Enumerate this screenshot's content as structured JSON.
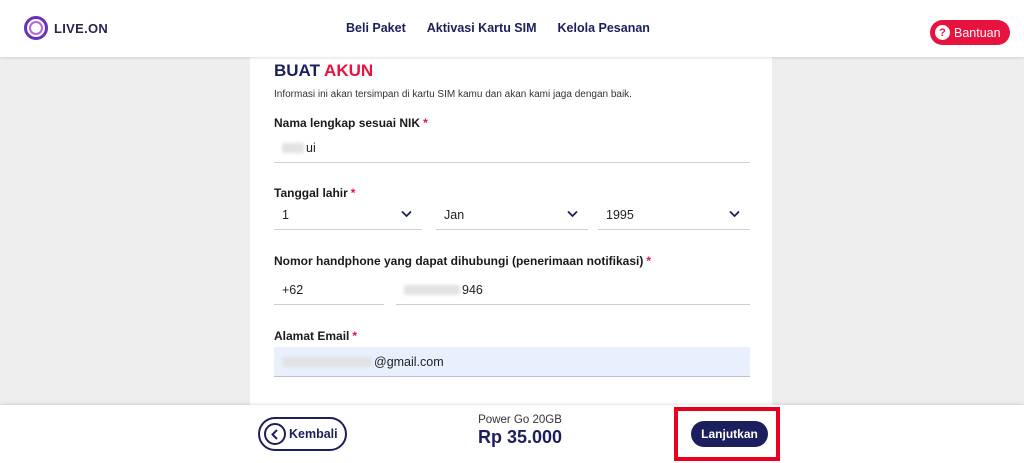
{
  "header": {
    "logo_text": "LIVE.ON",
    "nav": [
      "Beli Paket",
      "Aktivasi Kartu SIM",
      "Kelola Pesanan"
    ],
    "help_label": "Bantuan",
    "help_icon": "question-icon"
  },
  "form": {
    "title_main": "BUAT",
    "title_accent": "AKUN",
    "subtitle": "Informasi ini akan tersimpan di kartu SIM kamu dan akan kami jaga dengan baik.",
    "required_mark": "*",
    "name": {
      "label": "Nama lengkap sesuai NIK",
      "value_visible": "ui"
    },
    "dob": {
      "label": "Tanggal lahir",
      "day": "1",
      "month": "Jan",
      "year": "1995"
    },
    "phone": {
      "label": "Nomor handphone yang dapat dihubungi (penerimaan notifikasi)",
      "country_code": "+62",
      "value_visible": "946"
    },
    "email": {
      "label": "Alamat Email",
      "value_visible": "@gmail.com"
    }
  },
  "footer": {
    "back_label": "Kembali",
    "package_name": "Power Go 20GB",
    "price": "Rp 35.000",
    "next_label": "Lanjutkan"
  },
  "colors": {
    "brand_navy": "#1b1f5e",
    "accent_red": "#e8123f",
    "highlight_red": "#e8001f"
  }
}
